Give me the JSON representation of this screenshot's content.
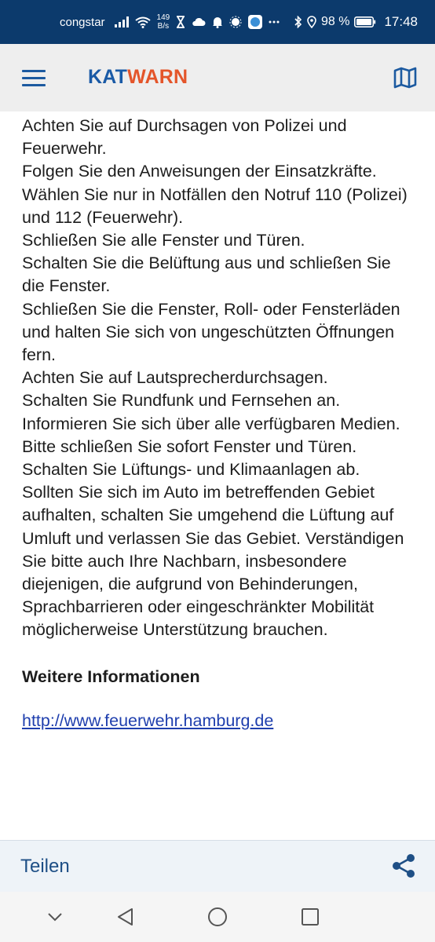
{
  "status_bar": {
    "carrier": "congstar",
    "speed_value": "149",
    "speed_unit": "B/s",
    "battery": "98 %",
    "time": "17:48"
  },
  "app_bar": {
    "logo_part1": "KAT",
    "logo_part2": "WARN",
    "brand_blue": "#1a5aa6",
    "brand_orange": "#e4552a"
  },
  "content": {
    "lines": [
      "Achten Sie auf Durchsagen von Polizei und Feuerwehr.",
      "Folgen Sie den Anweisungen der Einsatzkräfte.",
      "Wählen Sie nur in Notfällen den Notruf 110 (Polizei) und 112 (Feuerwehr).",
      "Schließen Sie alle Fenster und Türen.",
      "Schalten Sie die Belüftung aus und schließen Sie die Fenster.",
      "Schließen Sie die Fenster, Roll- oder Fensterläden und halten Sie sich von ungeschützten Öffnungen fern.",
      "Achten Sie auf Lautsprecherdurchsagen.",
      "Schalten Sie Rundfunk und Fernsehen an.",
      "Informieren Sie sich über alle verfügbaren Medien.",
      "Bitte schließen Sie sofort Fenster und Türen.",
      "Schalten Sie Lüftungs- und Klimaanlagen ab.",
      "Sollten Sie sich im Auto im betreffenden Gebiet aufhalten, schalten Sie umgehend die Lüftung auf Umluft und verlassen Sie das Gebiet. Verständigen Sie bitte auch Ihre Nachbarn, insbesondere diejenigen, die aufgrund von Behinderungen, Sprachbarrieren oder eingeschränkter Mobilität möglicherweise Unterstützung brauchen."
    ],
    "section_title": "Weitere Informationen",
    "link_text": "http://www.feuerwehr.hamburg.de"
  },
  "share_bar": {
    "label": "Teilen"
  }
}
